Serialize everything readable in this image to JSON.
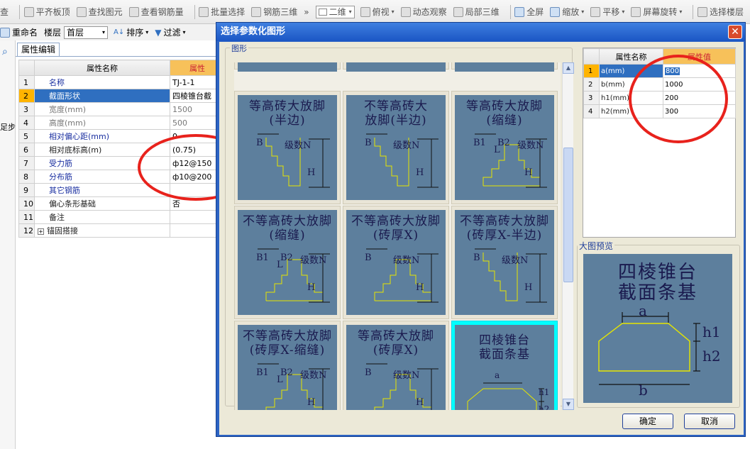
{
  "toolbar": {
    "items": [
      "查",
      "平齐板顶",
      "查找图元",
      "查看钢筋量",
      "批量选择",
      "钢筋三维",
      "二维",
      "俯视",
      "动态观察",
      "局部三维",
      "全屏",
      "缩放",
      "平移",
      "屏幕旋转",
      "选择楼层"
    ],
    "more": "»"
  },
  "toolbar2": {
    "rename": "重命名",
    "floor_label": "楼层",
    "floor_value": "首层",
    "sort": "排序",
    "filter": "过滤"
  },
  "left_edge": {
    "search_glyph": "⌕",
    "side_text": "足步"
  },
  "props": {
    "tab": "属性编辑",
    "headers": [
      "属性名称",
      "属性"
    ],
    "rows": [
      {
        "n": "1",
        "name": "名称",
        "value": "TJ-1-1",
        "style": "blue"
      },
      {
        "n": "2",
        "name": "截面形状",
        "value": "四棱锥台截",
        "style": "sel"
      },
      {
        "n": "3",
        "name": "宽度(mm)",
        "value": "1500",
        "style": "gray"
      },
      {
        "n": "4",
        "name": "高度(mm)",
        "value": "500",
        "style": "gray"
      },
      {
        "n": "5",
        "name": "相对偏心距(mm)",
        "value": "0",
        "style": "blue"
      },
      {
        "n": "6",
        "name": "相对底标高(m)",
        "value": "(0.75)",
        "style": "dark"
      },
      {
        "n": "7",
        "name": "受力筋",
        "value": "ф12@150",
        "style": "blue"
      },
      {
        "n": "8",
        "name": "分布筋",
        "value": "ф10@200",
        "style": "blue"
      },
      {
        "n": "9",
        "name": "其它钢筋",
        "value": "",
        "style": "blue"
      },
      {
        "n": "10",
        "name": "偏心条形基础",
        "value": "否",
        "style": "dark"
      },
      {
        "n": "11",
        "name": "备注",
        "value": "",
        "style": "dark"
      },
      {
        "n": "12",
        "name": "锚固搭接",
        "value": "",
        "style": "expand"
      }
    ]
  },
  "dialog": {
    "title": "选择参数化图形",
    "close": "✕",
    "shapes_label": "图形",
    "shapes": [
      {
        "title": "等高砖大放脚\n(半边)",
        "labels": [
          "B",
          "级数N",
          "H"
        ]
      },
      {
        "title": "不等高砖大\n放脚(半边)",
        "labels": [
          "B",
          "级数N",
          "H"
        ]
      },
      {
        "title": "等高砖大放脚\n(缩缝)",
        "labels": [
          "B1",
          "L",
          "B2",
          "级数N",
          "H"
        ]
      },
      {
        "title": "不等高砖大放脚\n(缩缝)",
        "labels": [
          "B1",
          "L",
          "B2",
          "级数N",
          "H"
        ]
      },
      {
        "title": "不等高砖大放脚\n(砖厚X)",
        "labels": [
          "B",
          "级数N",
          "H"
        ]
      },
      {
        "title": "不等高砖大放脚\n(砖厚X-半边)",
        "labels": [
          "B",
          "级数N",
          "H"
        ]
      },
      {
        "title": "不等高砖大放脚\n(砖厚X-缩缝)",
        "labels": [
          "B1",
          "L",
          "B2",
          "级数N",
          "H"
        ]
      },
      {
        "title": "等高砖大放脚\n(砖厚X)",
        "labels": [
          "B",
          "级数N",
          "H"
        ]
      },
      {
        "title": "四棱锥台\n截面条基",
        "labels": [
          "a",
          "h1",
          "h2",
          "b"
        ]
      }
    ],
    "params": {
      "headers": [
        "属性名称",
        "属性值"
      ],
      "rows": [
        {
          "n": "1",
          "name": "a(mm)",
          "value": "800"
        },
        {
          "n": "2",
          "name": "b(mm)",
          "value": "1000"
        },
        {
          "n": "3",
          "name": "h1(mm)",
          "value": "200"
        },
        {
          "n": "4",
          "name": "h2(mm)",
          "value": "300"
        }
      ]
    },
    "preview_label": "大图预览",
    "preview": {
      "title": "四棱锥台\n截面条基",
      "labels": [
        "a",
        "h1",
        "h2",
        "b"
      ]
    },
    "ok": "确定",
    "cancel": "取消"
  },
  "colors": {
    "title_bar": "#2c63c4",
    "diagram_bg": "#5d7f9d",
    "diagram_line": "#e6e600",
    "selection": "#2f6fc0",
    "highlight_header": "#f7c15a",
    "annotation": "#e8221c"
  }
}
